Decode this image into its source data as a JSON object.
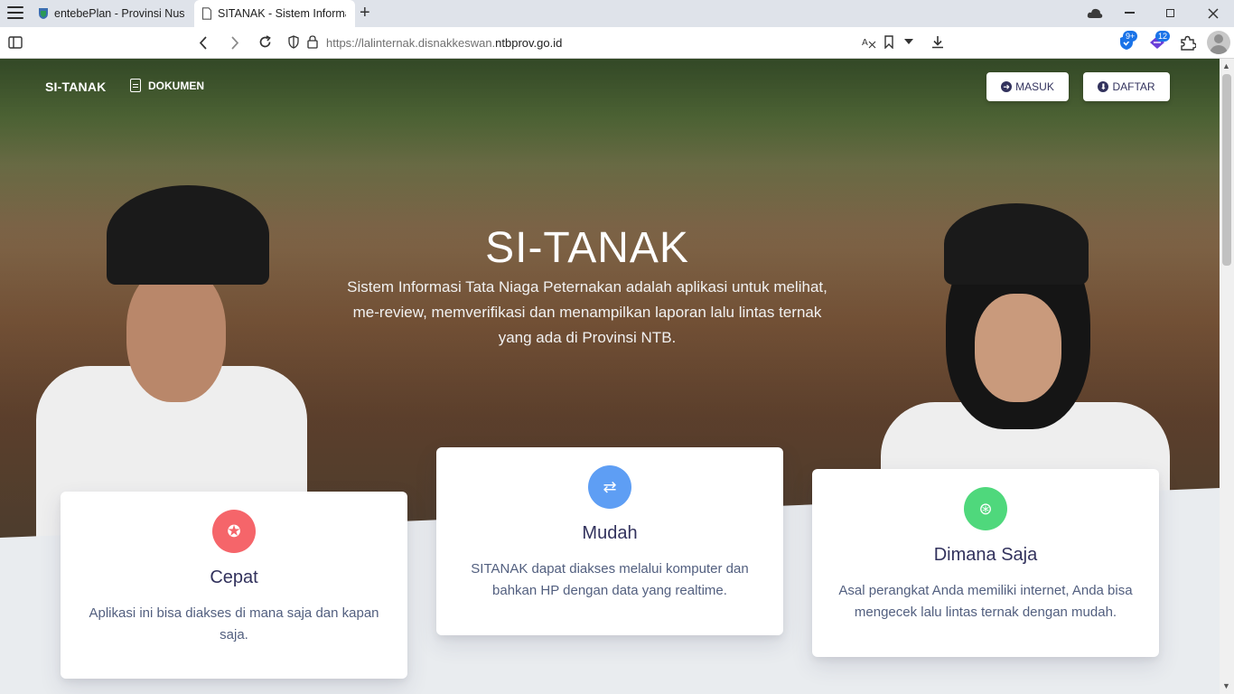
{
  "browser": {
    "tabs": [
      {
        "title": "entebePlan - Provinsi Nusa",
        "active": false
      },
      {
        "title": "SITANAK - Sistem Informas",
        "active": true
      }
    ],
    "new_tab_symbol": "+",
    "url_prefix": "https://lalinternak.disnakkeswan.",
    "url_domain": "ntbprov.go.id",
    "badges": {
      "shield": "9+",
      "ext": "12"
    },
    "icons": [
      "menu-icon",
      "sidebar-icon",
      "back-icon",
      "forward-icon",
      "reload-icon",
      "shield-icon",
      "lock-icon",
      "translate-icon",
      "bookmark-icon",
      "chevron-down-icon",
      "download-icon",
      "extension-icon",
      "profile-icon",
      "minimize-icon",
      "restore-icon",
      "close-icon",
      "cloud-icon"
    ]
  },
  "site": {
    "brand": "SI-TANAK",
    "doc_link": "DOKUMEN",
    "login": "MASUK",
    "register": "DAFTAR",
    "hero_title": "SI-TANAK",
    "hero_desc": "Sistem Informasi Tata Niaga Peternakan adalah aplikasi untuk melihat, me-review, memverifikasi dan menampilkan laporan lalu lintas ternak yang ada di Provinsi NTB."
  },
  "cards": [
    {
      "title": "Cepat",
      "desc": "Aplikasi ini bisa diakses di mana saja dan kapan saja.",
      "color": "#f5656a",
      "icon": "award-icon"
    },
    {
      "title": "Mudah",
      "desc": "SITANAK dapat diakses melalui komputer dan bahkan HP dengan data yang realtime.",
      "color": "#5e9ef4",
      "icon": "repeat-icon"
    },
    {
      "title": "Dimana Saja",
      "desc": "Asal perangkat Anda memiliki internet, Anda bisa mengecek lalu lintas ternak dengan mudah.",
      "color": "#4fd87c",
      "icon": "fingerprint-icon"
    }
  ]
}
